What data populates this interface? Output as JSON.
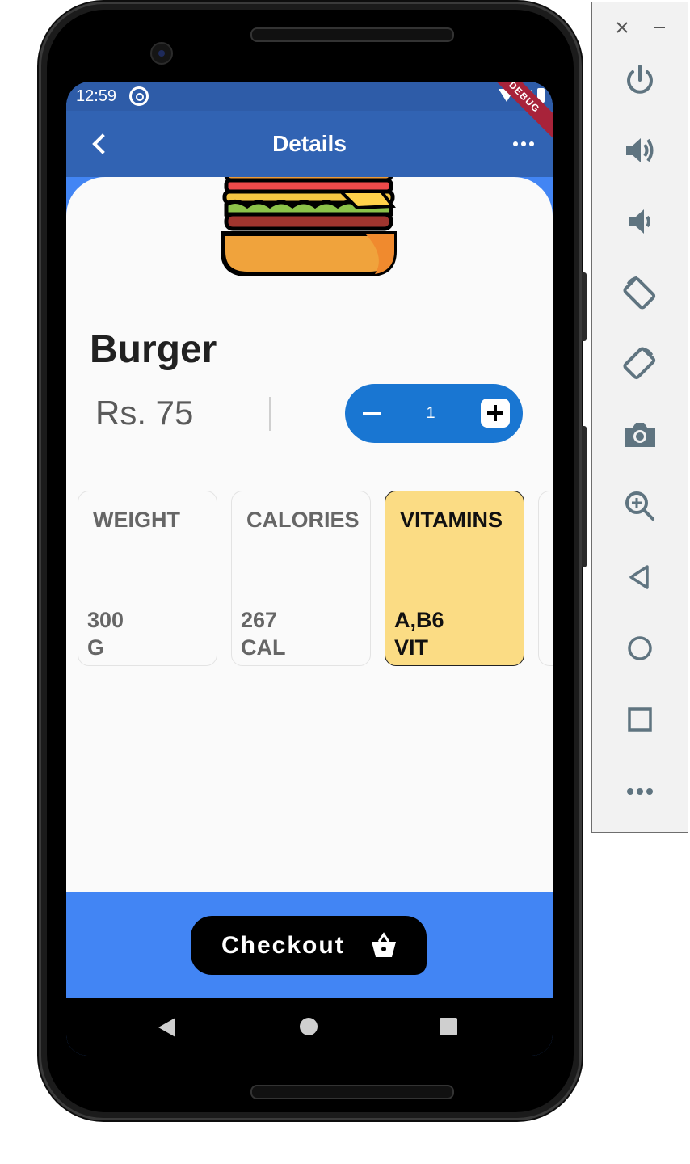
{
  "status_bar": {
    "time": "12:59",
    "debug_banner": "DEBUG"
  },
  "app_bar": {
    "title": "Details",
    "back_icon": "chevron-left-icon",
    "menu_icon": "more-horizontal-icon"
  },
  "product": {
    "name": "Burger",
    "price": "Rs. 75",
    "quantity": "1"
  },
  "nutrition": [
    {
      "label": "WEIGHT",
      "value_line1": "300",
      "value_line2": "G",
      "selected": false
    },
    {
      "label": "CALORIES",
      "value_line1": "267",
      "value_line2": "CAL",
      "selected": false
    },
    {
      "label": "VITAMINS",
      "value_line1": "A,B6",
      "value_line2": "VIT",
      "selected": true
    }
  ],
  "checkout": {
    "label": "Checkout",
    "icon": "basket-icon"
  },
  "colors": {
    "app_bar": "#3163b3",
    "accent_blue": "#4285f4",
    "stepper_blue": "#1976d2",
    "selected_card": "#fbdc84"
  },
  "emulator_panel": {
    "icons": [
      "close-icon",
      "minimize-icon",
      "power-icon",
      "volume-up-icon",
      "volume-down-icon",
      "rotate-left-icon",
      "rotate-right-icon",
      "camera-icon",
      "zoom-icon",
      "back-icon",
      "home-icon",
      "overview-icon",
      "more-icon"
    ]
  }
}
